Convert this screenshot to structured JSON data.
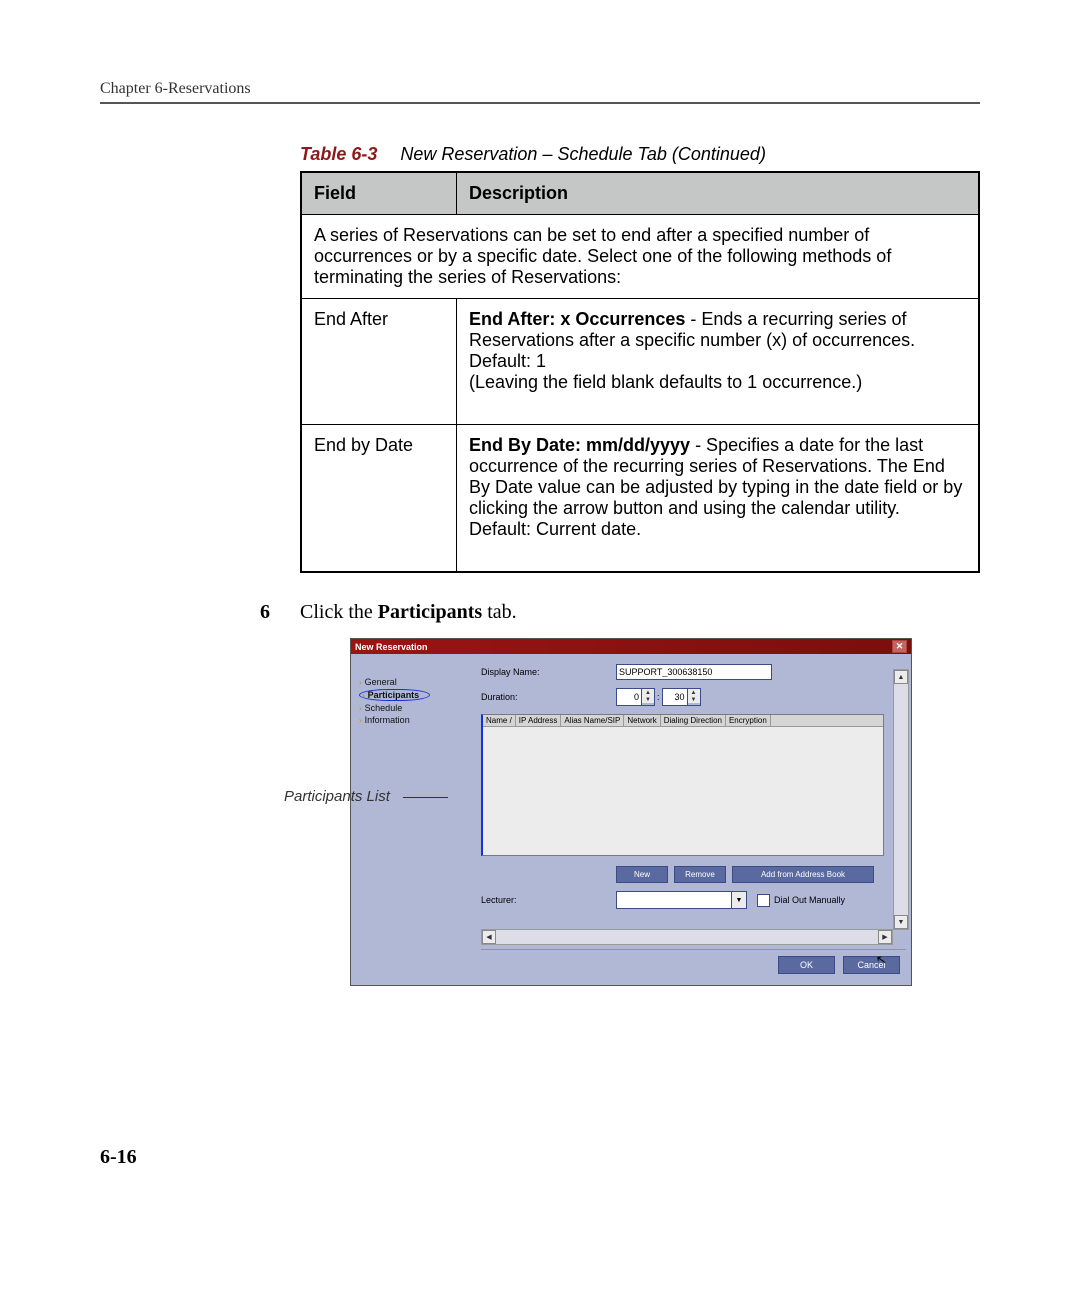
{
  "running_header": "Chapter 6-Reservations",
  "table_caption_label": "Table 6-3",
  "table_caption_text": "New Reservation – Schedule Tab (Continued)",
  "table": {
    "head_field": "Field",
    "head_desc": "Description",
    "intro": "A series of Reservations can be set to end after a specified number of occurrences or by a specific date. Select one of the following methods of terminating the series of Reservations:",
    "rows": [
      {
        "field": "End After",
        "bold": "End After: x Occurrences",
        "rest1": " - Ends a recurring series of Reservations after a specific number (x) of occurrences.",
        "line2": "Default: 1",
        "line3": "(Leaving the field blank defaults to 1 occurrence.)"
      },
      {
        "field": "End by Date",
        "bold": "End By Date: mm/dd/yyyy",
        "rest1": " - Specifies a date for the last occurrence of the recurring series of Reservations. The End By Date value can be adjusted by typing in the date field or by clicking the arrow button and using the calendar utility.",
        "line2": "Default: Current date.",
        "line3": ""
      }
    ]
  },
  "step_num": "6",
  "step_pre": "Click the ",
  "step_bold": "Participants",
  "step_post": " tab.",
  "annotation": "Participants List",
  "dialog": {
    "title": "New Reservation",
    "sidebar": {
      "general": "General",
      "participants": "Participants",
      "schedule": "Schedule",
      "information": "Information"
    },
    "display_name_label": "Display Name:",
    "display_name_value": "SUPPORT_300638150",
    "duration_label": "Duration:",
    "duration_hours": "0",
    "duration_minutes": "30",
    "grid_headers": {
      "name": "Name /",
      "ip": "IP Address",
      "alias": "Alias Name/SIP",
      "network": "Network",
      "dialing": "Dialing Direction",
      "encryption": "Encryption"
    },
    "btn_new": "New",
    "btn_remove": "Remove",
    "btn_add": "Add from Address Book",
    "lecturer_label": "Lecturer:",
    "dial_out_label": "Dial Out Manually",
    "btn_ok": "OK",
    "btn_cancel": "Cancel"
  },
  "page_number": "6-16"
}
